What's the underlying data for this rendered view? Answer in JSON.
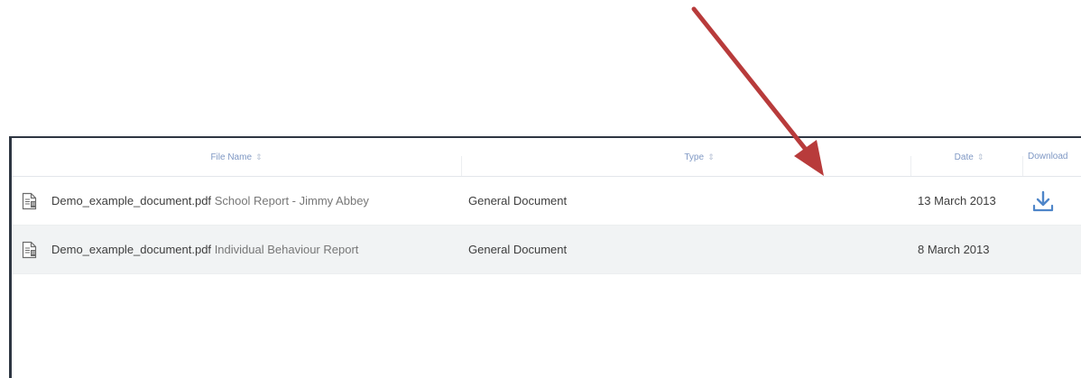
{
  "table": {
    "columns": {
      "file_name": "File Name",
      "type": "Type",
      "date": "Date",
      "download": "Download"
    },
    "sort_glyph": "⇕",
    "rows": [
      {
        "file": "Demo_example_document.pdf",
        "description": "School Report - Jimmy Abbey",
        "type": "General Document",
        "date": "13 March 2013",
        "has_download": true
      },
      {
        "file": "Demo_example_document.pdf",
        "description": "Individual Behaviour Report",
        "type": "General Document",
        "date": "8 March 2013",
        "has_download": false
      }
    ]
  },
  "icons": {
    "file": "document-icon",
    "download": "download-icon",
    "annotation": "red-arrow-annotation"
  },
  "colors": {
    "accent": "#4f86c9",
    "header_text": "#7f98c4",
    "arrow": "#b83b3b",
    "panel_border": "#2e3642",
    "alt_row": "#f1f3f4"
  }
}
